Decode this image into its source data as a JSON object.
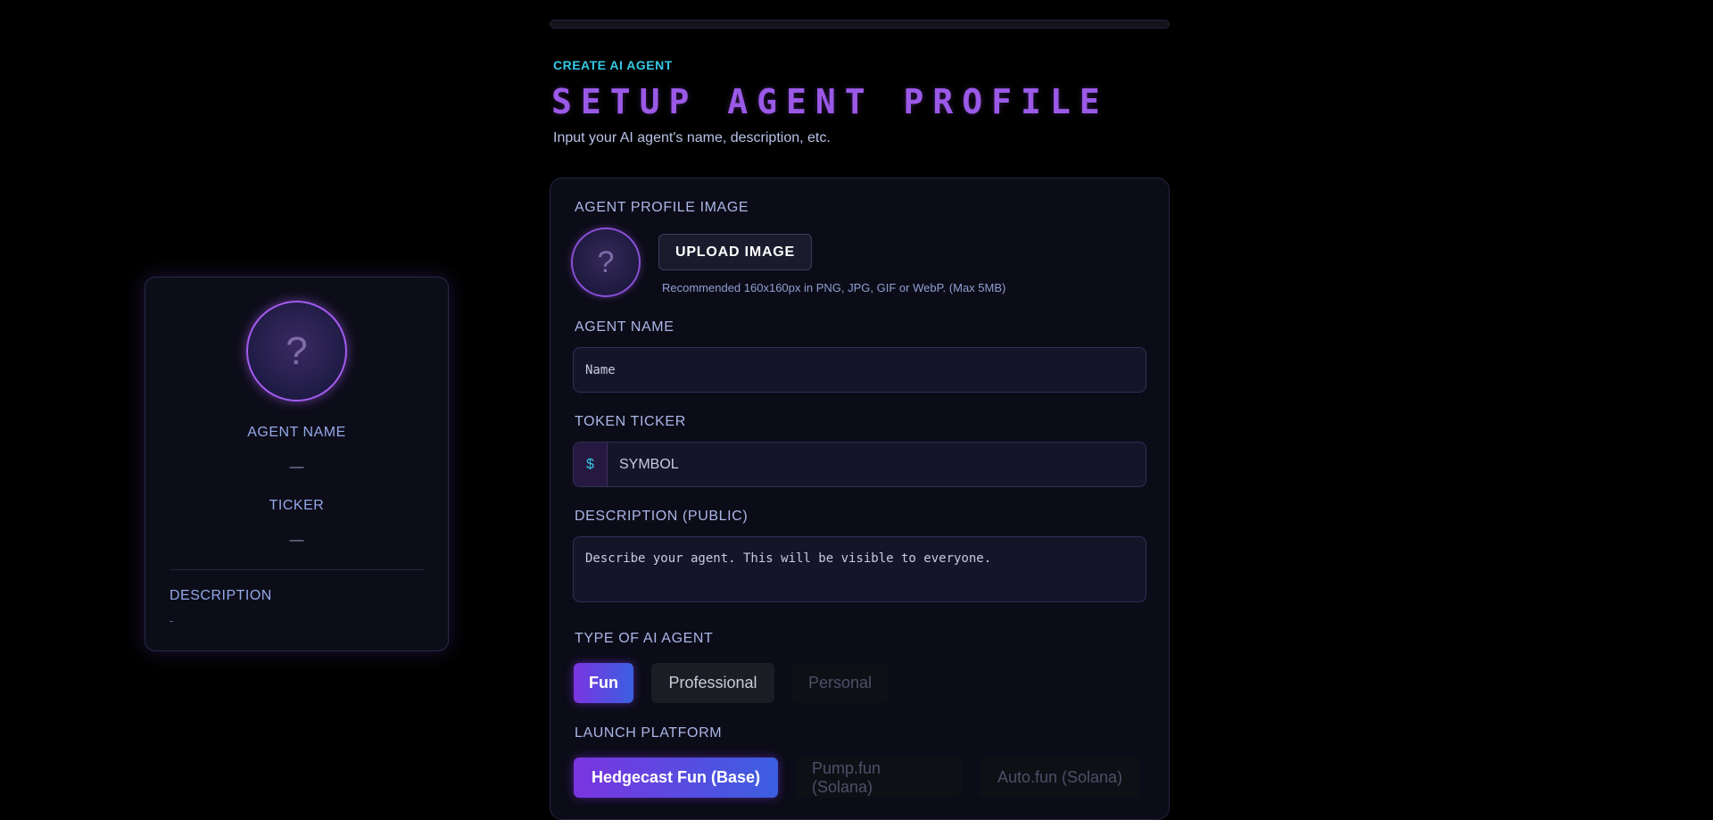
{
  "header": {
    "eyebrow": "CREATE AI AGENT",
    "title": "SETUP AGENT PROFILE",
    "subtitle": "Input your AI agent's name, description, etc."
  },
  "form": {
    "profile_image": {
      "label": "AGENT PROFILE IMAGE",
      "avatar_placeholder": "?",
      "upload_label": "UPLOAD IMAGE",
      "hint": "Recommended 160x160px in PNG, JPG, GIF or WebP. (Max 5MB)"
    },
    "agent_name": {
      "label": "AGENT NAME",
      "placeholder": "Name",
      "value": ""
    },
    "ticker": {
      "label": "TOKEN TICKER",
      "prefix": "$",
      "placeholder": "SYMBOL",
      "value": ""
    },
    "description": {
      "label": "DESCRIPTION (PUBLIC)",
      "placeholder": "Describe your agent. This will be visible to everyone.",
      "value": ""
    },
    "agent_type": {
      "label": "TYPE OF AI AGENT",
      "options": [
        {
          "label": "Fun",
          "state": "active"
        },
        {
          "label": "Professional",
          "state": "normal"
        },
        {
          "label": "Personal",
          "state": "muted"
        }
      ]
    },
    "launch_platform": {
      "label": "LAUNCH PLATFORM",
      "options": [
        {
          "label": "Hedgecast Fun (Base)",
          "state": "active"
        },
        {
          "label": "Pump.fun (Solana)",
          "state": "muted"
        },
        {
          "label": "Auto.fun (Solana)",
          "state": "muted"
        }
      ]
    }
  },
  "preview": {
    "avatar_placeholder": "?",
    "name_label": "AGENT NAME",
    "name_value": "—",
    "ticker_label": "TICKER",
    "ticker_value": "—",
    "description_label": "DESCRIPTION",
    "description_value": "-"
  },
  "colors": {
    "accent_cyan": "#35c9e6",
    "accent_purple": "#9b59e8",
    "gradient_start": "#7a35e0",
    "gradient_end": "#3b5fe0"
  }
}
